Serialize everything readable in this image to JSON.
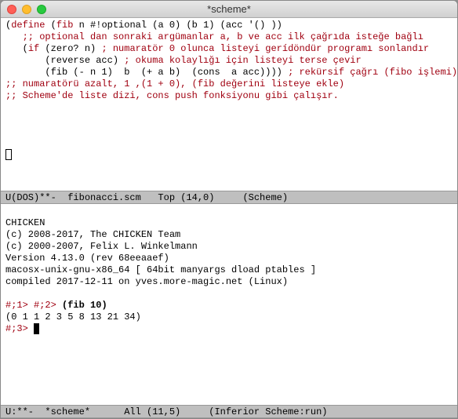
{
  "window": {
    "title": "*scheme*"
  },
  "editor": {
    "lines": {
      "l1a": "(",
      "l1b": "define",
      "l1c": " (",
      "l1d": "fib",
      "l1e": " n #!optional (a 0) (b 1) (acc '() ))",
      "l2": "   ;; optional dan sonraki argümanlar a, b ve acc ilk çağrıda isteğe bağlı",
      "l3a": "   (",
      "l3b": "if",
      "l3c": " (zero? n) ",
      "l3d": "; numaratör 0 olunca listeyi gerídöndür programı sonlandır",
      "l4a": "       (reverse acc) ",
      "l4b": "; okuma kolaylığı için listeyi terse çevir",
      "l5a": "       (fib (- n 1)  b  (+ a b)  (cons  a acc)))) ",
      "l5b": "; rekürsif çağrı (fibo işlemi)",
      "l6": ";; numaratörü azalt, 1 ,(1 + 0), (fib değerini listeye ekle)",
      "l7": ";; Scheme'de liste dizi, cons push fonksiyonu gibi çalışır."
    }
  },
  "modeline_top": "U(DOS)**-  fibonacci.scm   Top (14,0)     (Scheme)",
  "repl": {
    "banner": {
      "l1": "CHICKEN",
      "l2": "(c) 2008-2017, The CHICKEN Team",
      "l3": "(c) 2000-2007, Felix L. Winkelmann",
      "l4": "Version 4.13.0 (rev 68eeaaef)",
      "l5": "macosx-unix-gnu-x86_64 [ 64bit manyargs dload ptables ]",
      "l6": "compiled 2017-12-11 on yves.more-magic.net (Linux)"
    },
    "p1": "#;1> ",
    "p2": "#;2> ",
    "in": "(fib 10)",
    "out": "(0 1 1 2 3 5 8 13 21 34)",
    "p3": "#;3> "
  },
  "modeline_bottom": "U:**-  *scheme*      All (11,5)     (Inferior Scheme:run)"
}
